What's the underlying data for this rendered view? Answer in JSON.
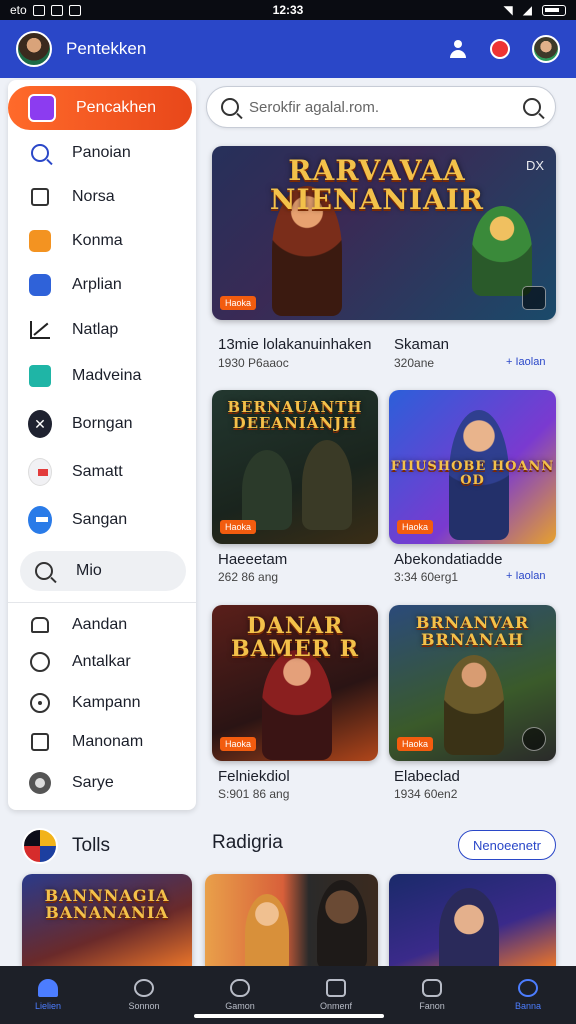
{
  "status_bar": {
    "left": "eto",
    "time": "12:33"
  },
  "app_bar": {
    "title": "Pentekken"
  },
  "sidebar": {
    "items": [
      {
        "label": "Pencakhen",
        "icon": "app-icon"
      },
      {
        "label": "Panoian",
        "icon": "search-icon"
      },
      {
        "label": "Norsa",
        "icon": "box-icon"
      },
      {
        "label": "Konma",
        "icon": "orange-app-icon"
      },
      {
        "label": "Arplian",
        "icon": "blue-app-icon"
      },
      {
        "label": "Natlap",
        "icon": "trend-icon"
      },
      {
        "label": "Madveina",
        "icon": "teal-app-icon"
      },
      {
        "label": "Borngan",
        "icon": "x-icon"
      },
      {
        "label": "Samatt",
        "icon": "flag-icon"
      },
      {
        "label": "Sangan",
        "icon": "blue-circle-icon"
      },
      {
        "label": "Mio",
        "icon": "search-icon"
      },
      {
        "label": "Aandan",
        "icon": "home-icon"
      },
      {
        "label": "Antalkar",
        "icon": "face-icon"
      },
      {
        "label": "Kampann",
        "icon": "dot-circle-icon"
      },
      {
        "label": "Manonam",
        "icon": "square-icon"
      },
      {
        "label": "Sarye",
        "icon": "grey-circle-icon"
      }
    ]
  },
  "search": {
    "placeholder": "Serokfir agalal.rom."
  },
  "featured": {
    "banner_title": "RARVAVAA NIENANIAIR",
    "tag": "DX",
    "badge": "Haoka",
    "title_left": "13mie lolakanuinhaken",
    "title_right": "Skaman",
    "meta_left": "1930 P6aaoc",
    "meta_right": "320ane",
    "link": "+ Iaolan"
  },
  "games": [
    {
      "banner": "BERNAUANTH DEEANIANJH",
      "badge": "Haoka",
      "title": "Haeeetam",
      "meta": "262 86 ang",
      "link": ""
    },
    {
      "banner": "FIIUSHOBE HOANN OD",
      "badge": "Haoka",
      "title": "Abekondatiadde",
      "meta": "3:34 60erg1",
      "link": "+ Iaolan"
    },
    {
      "banner": "DANAR BAMER R",
      "badge": "Haoka",
      "title": "Felniekdiol",
      "meta": "S:901 86 ang",
      "link": ""
    },
    {
      "banner": "BRNANVAR BRNANAH",
      "badge": "Haoka",
      "title": "Elabeclad",
      "meta": "1934 60en2",
      "link": ""
    }
  ],
  "tools_section": {
    "label": "Tolls"
  },
  "categories_section": {
    "title": "Radigria",
    "button": "Nenoeenetr"
  },
  "bottom_banners": [
    "BANNNAGIA BANANANIA"
  ],
  "bottom_nav": [
    {
      "label": "Lielien",
      "icon": "home-icon"
    },
    {
      "label": "Sonnon",
      "icon": "search-icon"
    },
    {
      "label": "Gamon",
      "icon": "shield-icon"
    },
    {
      "label": "Onmenf",
      "icon": "grid-icon"
    },
    {
      "label": "Fanon",
      "icon": "gamepad-icon"
    },
    {
      "label": "Banna",
      "icon": "user-icon"
    }
  ],
  "colors": {
    "appbar": "#2a47c8",
    "accent": "#e8471a",
    "bottom_nav": "#1d2028"
  }
}
